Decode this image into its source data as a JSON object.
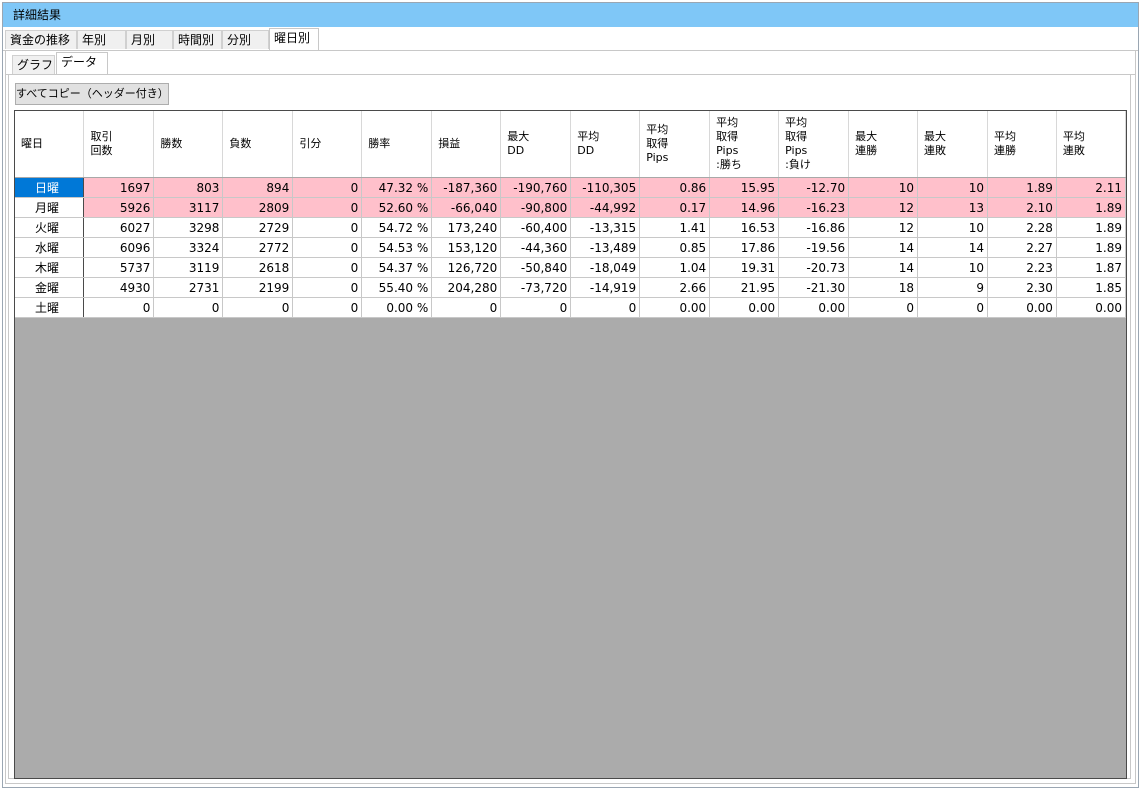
{
  "window": {
    "title": "詳細結果"
  },
  "outer_tabs": [
    {
      "label": "資金の推移",
      "active": false
    },
    {
      "label": "年別",
      "active": false
    },
    {
      "label": "月別",
      "active": false
    },
    {
      "label": "時間別",
      "active": false
    },
    {
      "label": "分別",
      "active": false
    },
    {
      "label": "曜日別",
      "active": true
    }
  ],
  "inner_tabs": [
    {
      "label": "グラフ",
      "active": false
    },
    {
      "label": "データ",
      "active": true
    }
  ],
  "toolbar": {
    "copy_label": "すべてコピー（ヘッダー付き）"
  },
  "table": {
    "columns": [
      "曜日",
      "取引\n回数",
      "勝数",
      "負数",
      "引分",
      "勝率",
      "損益",
      "最大\nDD",
      "平均\nDD",
      "平均\n取得\nPips",
      "平均\n取得\nPips\n:勝ち",
      "平均\n取得\nPips\n:負け",
      "最大\n連勝",
      "最大\n連敗",
      "平均\n連勝",
      "平均\n連敗"
    ],
    "rows": [
      {
        "cells": [
          "日曜",
          "1697",
          "803",
          "894",
          "0",
          "47.32 %",
          "-187,360",
          "-190,760",
          "-110,305",
          "0.86",
          "15.95",
          "-12.70",
          "10",
          "10",
          "1.89",
          "2.11"
        ],
        "highlight": true,
        "selected": true
      },
      {
        "cells": [
          "月曜",
          "5926",
          "3117",
          "2809",
          "0",
          "52.60 %",
          "-66,040",
          "-90,800",
          "-44,992",
          "0.17",
          "14.96",
          "-16.23",
          "12",
          "13",
          "2.10",
          "1.89"
        ],
        "highlight": true,
        "selected": false
      },
      {
        "cells": [
          "火曜",
          "6027",
          "3298",
          "2729",
          "0",
          "54.72 %",
          "173,240",
          "-60,400",
          "-13,315",
          "1.41",
          "16.53",
          "-16.86",
          "12",
          "10",
          "2.28",
          "1.89"
        ],
        "highlight": false,
        "selected": false
      },
      {
        "cells": [
          "水曜",
          "6096",
          "3324",
          "2772",
          "0",
          "54.53 %",
          "153,120",
          "-44,360",
          "-13,489",
          "0.85",
          "17.86",
          "-19.56",
          "14",
          "14",
          "2.27",
          "1.89"
        ],
        "highlight": false,
        "selected": false
      },
      {
        "cells": [
          "木曜",
          "5737",
          "3119",
          "2618",
          "0",
          "54.37 %",
          "126,720",
          "-50,840",
          "-18,049",
          "1.04",
          "19.31",
          "-20.73",
          "14",
          "10",
          "2.23",
          "1.87"
        ],
        "highlight": false,
        "selected": false
      },
      {
        "cells": [
          "金曜",
          "4930",
          "2731",
          "2199",
          "0",
          "55.40 %",
          "204,280",
          "-73,720",
          "-14,919",
          "2.66",
          "21.95",
          "-21.30",
          "18",
          "9",
          "2.30",
          "1.85"
        ],
        "highlight": false,
        "selected": false
      },
      {
        "cells": [
          "土曜",
          "0",
          "0",
          "0",
          "0",
          "0.00 %",
          "0",
          "0",
          "0",
          "0.00",
          "0.00",
          "0.00",
          "0",
          "0",
          "0.00",
          "0.00"
        ],
        "highlight": false,
        "selected": false
      }
    ]
  },
  "colors": {
    "titlebar": "#7fc7f7",
    "loss_row": "#ffc0cb",
    "selection": "#0078d7",
    "grid_empty": "#ababab"
  }
}
